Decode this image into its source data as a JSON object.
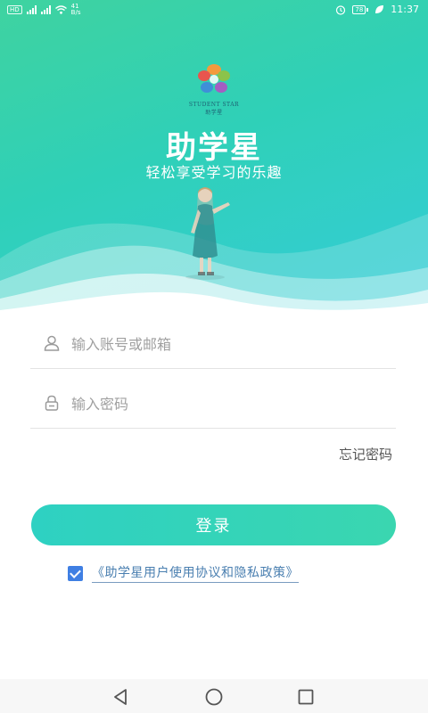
{
  "status_bar": {
    "left_badge": "HD",
    "net_speed_value": "41",
    "net_speed_unit": "B/s",
    "battery": "78",
    "time": "11:37"
  },
  "brand": {
    "logo_text": "STUDENT STAR",
    "logo_subtext": "助学星",
    "title": "助学星",
    "slogan": "轻松享受学习的乐趣"
  },
  "login_form": {
    "account_placeholder": "输入账号或邮箱",
    "account_value": "",
    "password_placeholder": "输入密码",
    "password_value": "",
    "forgot_label": "忘记密码",
    "login_label": "登录"
  },
  "agreement": {
    "checked": true,
    "label": "《助学星用户使用协议和隐私政策》"
  },
  "colors": {
    "gradient_start": "#3fd3a0",
    "gradient_end": "#35cdd8",
    "checkbox": "#3f7fe3",
    "link": "#4a7fb0"
  },
  "icons": {
    "account": "user-icon",
    "password": "lock-icon",
    "nav_back": "back-triangle-icon",
    "nav_home": "home-circle-icon",
    "nav_recent": "recent-square-icon"
  }
}
